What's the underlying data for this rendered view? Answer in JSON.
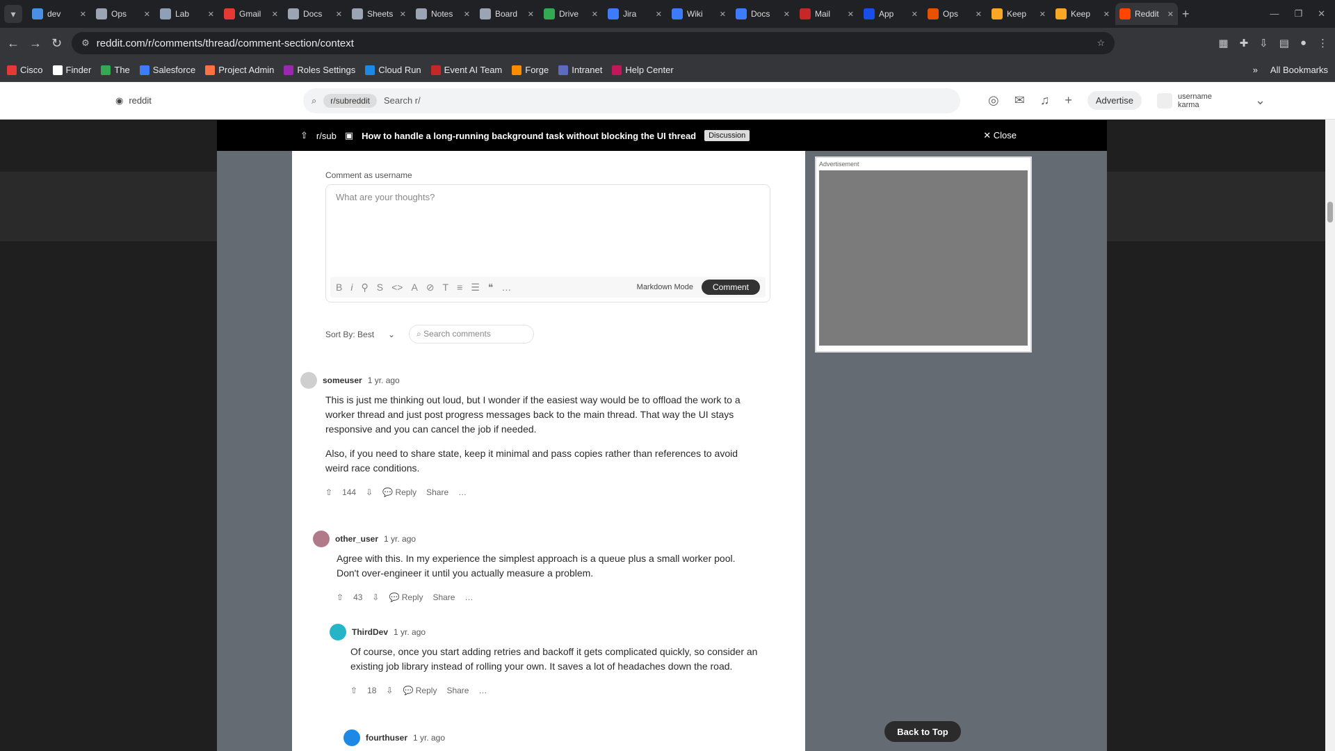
{
  "browser": {
    "tabs": [
      {
        "title": "dev",
        "color": "#4a90e2"
      },
      {
        "title": "Ops",
        "color": "#9aa4b2"
      },
      {
        "title": "Lab",
        "color": "#8f9fb5"
      },
      {
        "title": "Gmail",
        "color": "#e53935"
      },
      {
        "title": "Docs",
        "color": "#9aa4b2"
      },
      {
        "title": "Sheets",
        "color": "#9aa4b2"
      },
      {
        "title": "Notes",
        "color": "#9aa4b2"
      },
      {
        "title": "Board",
        "color": "#9aa4b2"
      },
      {
        "title": "Drive",
        "color": "#34a853"
      },
      {
        "title": "Jira",
        "color": "#3e7bfa"
      },
      {
        "title": "Wiki",
        "color": "#3e7bfa"
      },
      {
        "title": "Docs",
        "color": "#3e7bfa"
      },
      {
        "title": "Mail",
        "color": "#c62828"
      },
      {
        "title": "App",
        "color": "#1a4ee8"
      },
      {
        "title": "Ops",
        "color": "#e65100"
      },
      {
        "title": "Keep",
        "color": "#f9a825"
      },
      {
        "title": "Keep",
        "color": "#f9a825"
      },
      {
        "title": "Reddit",
        "color": "#ff4500",
        "active": true
      }
    ],
    "url": "reddit.com/r/comments/thread/comment-section/context",
    "bookmarks": [
      "Cisco",
      "Finder",
      "The",
      "Salesforce",
      "Project Admin",
      "Roles Settings",
      "Cloud Run",
      "Event AI Team",
      "Forge",
      "Intranet",
      "Help Center"
    ],
    "bookmarks_more": "All Bookmarks"
  },
  "site": {
    "logo_text": "reddit",
    "search_chip": "r/subreddit",
    "search_placeholder": "Search r/",
    "advertise": "Advertise",
    "account_line1": "username",
    "account_line2": "karma"
  },
  "post": {
    "community": "r/sub",
    "title": "How to handle a long-running background task without blocking the UI thread",
    "flair": "Discussion",
    "close": "Close"
  },
  "comment_box": {
    "label": "Comment as username",
    "placeholder": "What are your thoughts?",
    "markdown": "Markdown Mode",
    "submit": "Comment"
  },
  "sort": {
    "label": "Sort By: Best",
    "search_placeholder": "Search comments"
  },
  "comments": [
    {
      "user": "someuser",
      "time": "1 yr. ago",
      "p1": "This is just me thinking out loud, but I wonder if the easiest way would be to offload the work to a worker thread and just post progress messages back to the main thread. That way the UI stays responsive and you can cancel the job if needed.",
      "p2": "Also, if you need to share state, keep it minimal and pass copies rather than references to avoid weird race conditions.",
      "votes": "144",
      "reply": "Reply",
      "share": "Share"
    },
    {
      "user": "other_user",
      "time": "1 yr. ago",
      "p1": "Agree with this. In my experience the simplest approach is a queue plus a small worker pool. Don't over-engineer it until you actually measure a problem.",
      "votes": "43",
      "reply": "Reply",
      "share": "Share"
    },
    {
      "user": "ThirdDev",
      "time": "1 yr. ago",
      "p1": "Of course, once you start adding retries and backoff it gets complicated quickly, so consider an existing job library instead of rolling your own. It saves a lot of headaches down the road.",
      "votes": "18",
      "reply": "Reply",
      "share": "Share"
    },
    {
      "user": "fourthuser",
      "time": "1 yr. ago"
    }
  ],
  "sidebar_label": "Advertisement",
  "scroll_pill": "Back to Top"
}
